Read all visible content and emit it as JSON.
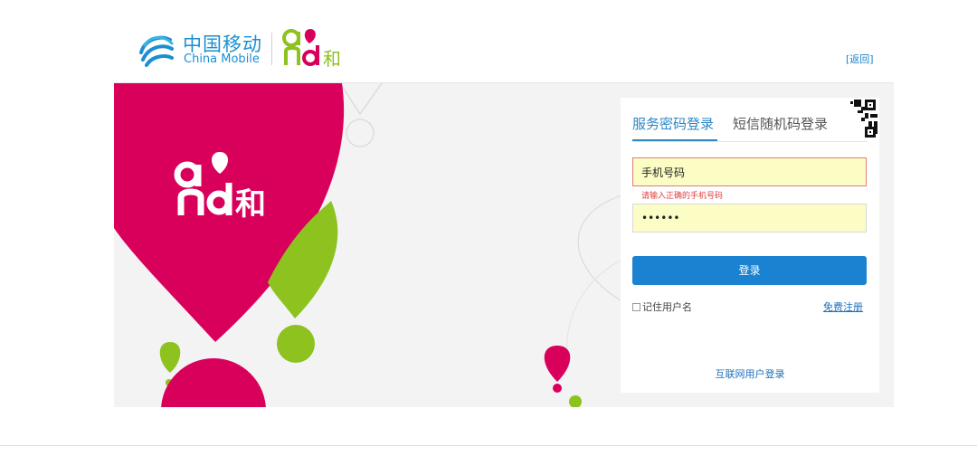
{
  "header": {
    "brand_cn": "中国移动",
    "brand_en": "China Mobile",
    "back_link": "[返回]"
  },
  "banner": {
    "and_he": "和"
  },
  "login": {
    "tabs": [
      {
        "label": "服务密码登录",
        "active": true
      },
      {
        "label": "短信随机码登录",
        "active": false
      }
    ],
    "phone_value": "手机号码",
    "phone_error": "请输入正确的手机号码",
    "password_value": "••••••",
    "login_button": "登录",
    "remember_label": "记住用户名",
    "register_link": "免费注册",
    "internet_user_login": "互联网用户登录"
  },
  "colors": {
    "brand_blue": "#1a8fd2",
    "and_pink": "#d9005c",
    "and_green": "#8dc21f",
    "button_blue": "#1a82d0",
    "field_yellow": "#fbfdc4"
  }
}
